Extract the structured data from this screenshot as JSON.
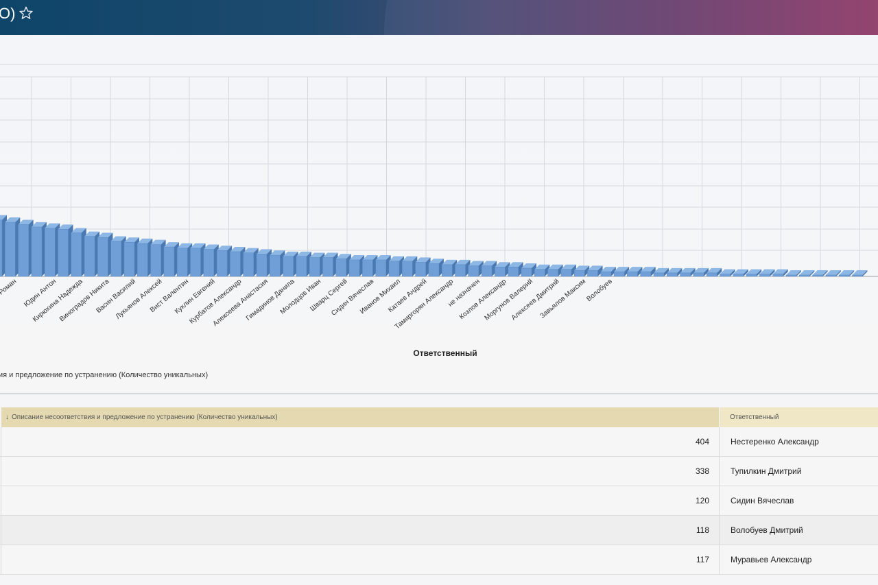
{
  "header": {
    "title": "O)",
    "star_icon": "star-outline-icon"
  },
  "chart_data": {
    "type": "bar",
    "xlabel": "Ответственный",
    "legend": "ия и предложение по устранению (Количество уникальных)",
    "grid": true,
    "categories": [
      "",
      "Виноградов Роман",
      "",
      "",
      "Юдин Антон",
      "",
      "Кирюхина Надежда",
      "",
      "Виноградов Никита",
      "",
      "Васин Василий",
      "",
      "Лукьянов Алексей",
      "",
      "Вист Валентин",
      "",
      "Куклин Евгений",
      "",
      "Курбатов Александр",
      "",
      "Алексеева Анастасия",
      "",
      "Гимадинов Данила",
      "",
      "Молодцов Иван",
      "",
      "Шварц Сергей",
      "",
      "Сидин Вячеслав",
      "",
      "Иванов Михаил",
      "",
      "Катаев Андрей",
      "",
      "Тамиргорян Александр",
      "",
      "не назначен",
      "",
      "Козлов Александр",
      "",
      "Моргунов Валерий",
      "",
      "Алексеев Дмитрий",
      "",
      "Завьялов Максим",
      "",
      "Волобуев",
      ""
    ],
    "values": [
      24,
      23,
      22,
      21,
      20.5,
      20,
      18.5,
      17,
      16.5,
      15,
      14.5,
      14,
      13.5,
      12.5,
      12,
      12,
      11.5,
      11,
      10.5,
      10,
      9.5,
      9,
      8.5,
      8.5,
      8,
      8,
      7.5,
      7,
      7,
      7,
      6.5,
      6.5,
      6,
      5.5,
      5,
      5,
      4.5,
      4.5,
      4,
      4,
      3.5,
      3,
      3,
      3,
      2.5,
      2.5,
      2,
      2,
      2,
      2,
      1.5,
      1.5,
      1.5,
      1.5,
      1.5,
      1,
      1,
      1,
      1,
      1,
      0.5,
      0.5,
      0.5,
      0.5,
      0.5,
      0.5
    ]
  },
  "table": {
    "col_left_header": "Описание несоответствия и предложение по устранению (Количество уникальных)",
    "col_left_arrow": "↓",
    "col_right_header": "Ответственный",
    "rows": [
      {
        "count": "404",
        "name": "Нестеренко Александр"
      },
      {
        "count": "338",
        "name": "Тупилкин Дмитрий"
      },
      {
        "count": "120",
        "name": "Сидин Вячеслав"
      },
      {
        "count": "118",
        "name": "Волобуев Дмитрий"
      },
      {
        "count": "117",
        "name": "Муравьев Александр"
      }
    ]
  },
  "colors": {
    "bar_front": "#6f9fd6",
    "bar_side": "#4a78b0",
    "bar_top": "#8db8e6",
    "grid": "#d5d9de",
    "header_start": "#0e4569",
    "header_end": "#8e3a68"
  }
}
